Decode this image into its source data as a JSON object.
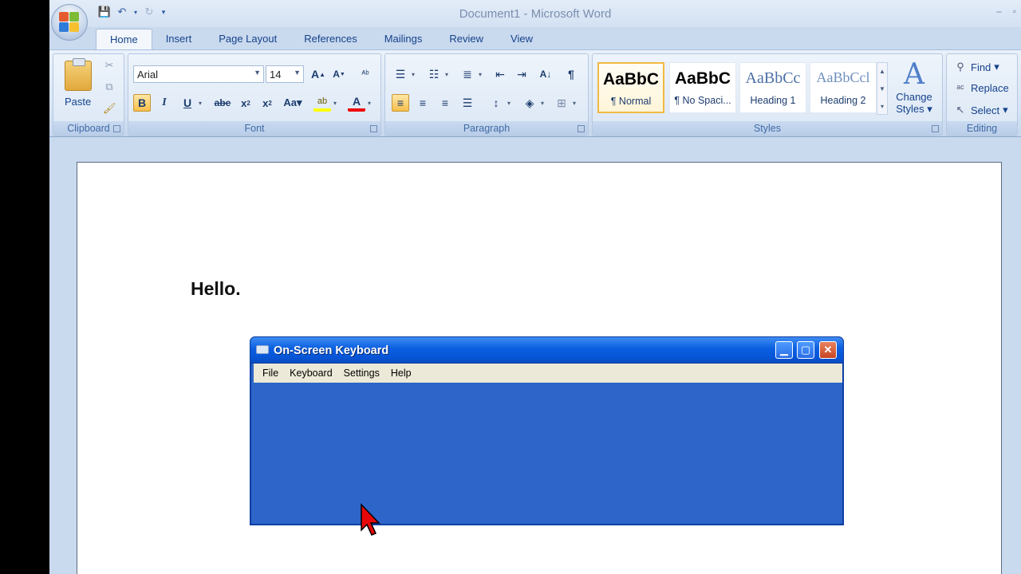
{
  "app": {
    "title": "Document1 - Microsoft Word"
  },
  "tabs": [
    "Home",
    "Insert",
    "Page Layout",
    "References",
    "Mailings",
    "Review",
    "View"
  ],
  "ribbon": {
    "clipboard": {
      "paste_label": "Paste",
      "group_label": "Clipboard"
    },
    "font": {
      "font_name": "Arial",
      "font_size": "14",
      "group_label": "Font"
    },
    "paragraph": {
      "group_label": "Paragraph"
    },
    "styles": {
      "group_label": "Styles",
      "items": [
        {
          "sample": "AaBbC",
          "name": "¶ Normal"
        },
        {
          "sample": "AaBbC",
          "name": "¶ No Spaci..."
        },
        {
          "sample": "AaBbCc",
          "name": "Heading 1"
        },
        {
          "sample": "AaBbCcl",
          "name": "Heading 2"
        }
      ],
      "change_styles": "Change Styles"
    },
    "editing": {
      "group_label": "Editing",
      "find": "Find",
      "replace": "Replace",
      "select": "Select"
    }
  },
  "document": {
    "text": "Hello."
  },
  "osk": {
    "title": "On-Screen Keyboard",
    "menu": [
      "File",
      "Keyboard",
      "Settings",
      "Help"
    ]
  },
  "colors": {
    "title_blue": "#0a5fe0",
    "ribbon_bg": "#d6e3f3",
    "accent_gold": "#f2b943"
  }
}
